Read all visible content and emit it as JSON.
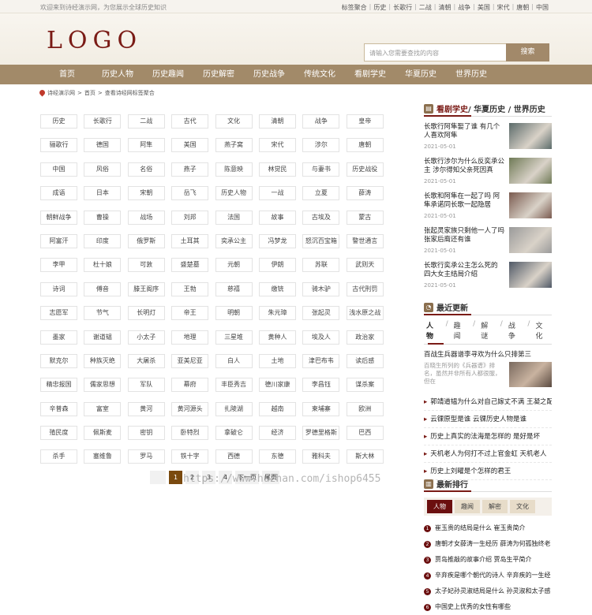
{
  "topbar": {
    "welcome": "欢迎来到诗经演示网，为您展示全球历史知识",
    "links": [
      "标签聚合",
      "历史",
      "长歌行",
      "二战",
      "清朝",
      "战争",
      "美国",
      "宋代",
      "唐朝",
      "中国"
    ]
  },
  "header": {
    "logo": "LOGO",
    "search_placeholder": "请输入您需要查找的内容",
    "search_button": "搜索"
  },
  "nav": [
    "首页",
    "历史人物",
    "历史趣闻",
    "历史解密",
    "历史战争",
    "传统文化",
    "看剧学史",
    "华夏历史",
    "世界历史"
  ],
  "breadcrumb": {
    "home": "诗经演示网",
    "sep": ">",
    "current_home": "首页",
    "current": "查看诗经网标签聚合"
  },
  "tags": [
    "历史",
    "长歌行",
    "二战",
    "古代",
    "文化",
    "清朝",
    "战争",
    "皇帝",
    "骊歌行",
    "德国",
    "阿隼",
    "美国",
    "燕子窝",
    "宋代",
    "涉尔",
    "唐朝",
    "中国",
    "风俗",
    "名俗",
    "燕子",
    "陈意映",
    "林觉民",
    "与妻书",
    "历史战役",
    "成语",
    "日本",
    "宋朝",
    "岳飞",
    "历史人物",
    "一战",
    "立夏",
    "薛涛",
    "朝鲜战争",
    "曹操",
    "战场",
    "刘邦",
    "法国",
    "故事",
    "古埃及",
    "蒙古",
    "阿富汗",
    "印度",
    "俄罗斯",
    "土耳其",
    "奕承公主",
    "冯梦龙",
    "怒沉百宝箱",
    "警世通言",
    "李甲",
    "杜十娘",
    "可敦",
    "盛楚墓",
    "元朝",
    "伊朗",
    "苏联",
    "武则天",
    "诗词",
    "傅音",
    "滕王阁序",
    "王勃",
    "慈禧",
    "缴铳",
    "骑木驴",
    "古代刑罚",
    "志愿军",
    "节气",
    "长明灯",
    "帝王",
    "明朝",
    "朱元璋",
    "张起灵",
    "浅水原之战",
    "墨家",
    "谢道韫",
    "小太子",
    "地理",
    "三星堆",
    "黄种人",
    "埃及人",
    "政治家",
    "默克尔",
    "种族灭绝",
    "大屠杀",
    "亚美尼亚",
    "白人",
    "土地",
    "津巴布韦",
    "读后感",
    "精忠报国",
    "儒家思想",
    "军队",
    "幕府",
    "丰臣秀吉",
    "德川家康",
    "李昌钰",
    "谋杀案",
    "辛普森",
    "富室",
    "黄河",
    "黄河源头",
    "扎陵湖",
    "越南",
    "柬埔寨",
    "欧洲",
    "殖民度",
    "佩斯麦",
    "密钥",
    "卧特烈",
    "拿破仑",
    "经济",
    "罗德里格斯",
    "巴西",
    "杀手",
    "塞维鲁",
    "罗马",
    "铁十字",
    "西德",
    "东德",
    "雅科夫",
    "斯大林"
  ],
  "pager": {
    "pages": [
      "1",
      "2",
      "3",
      "4"
    ],
    "current": "1",
    "next": "下一页",
    "last": "尾页"
  },
  "watermark": "https://www.huzhan.com/ishop6455",
  "sidebar1": {
    "title_hl": "看剧学史",
    "title_rest": " / 华夏历史 / 世界历史",
    "items": [
      {
        "title": "长歌行阿隼娶了谁 有几个人喜欢阿隼",
        "date": "2021-05-01"
      },
      {
        "title": "长歌行涉尔为什么反奕承公主 涉尔得知父亲死因真",
        "date": "2021-05-01"
      },
      {
        "title": "长歌和阿隼在一起了吗 阿隼承诺同长歌一起隐居",
        "date": "2021-05-01"
      },
      {
        "title": "张起灵家族只剩他一人了吗 张家后裔还有谁",
        "date": "2021-05-01"
      },
      {
        "title": "长歌行奕承公主怎么死的 四大女主结局介绍",
        "date": "2021-05-01"
      }
    ],
    "pic_colors": [
      "#5b6b6a",
      "#6f7a56",
      "#7a5a4f",
      "#9a9a9a",
      "#4f5866"
    ]
  },
  "sidebar2": {
    "title": "最近更新",
    "tabs": [
      "人物",
      "趣闻",
      "解谜",
      "战争",
      "文化"
    ],
    "first_title": "百战生兵器谱李寻欢为什么只排第三",
    "first_desc": "百晓生所列的《兵器谱》排名，虽然并非所有人都很服，但在",
    "items": [
      "郭靖道韫为什么对自己嫁丈不满 王凝之配",
      "云锞原型是谁 云锞历史人物是谁",
      "历史上真实的法海是怎样的 是好是坏",
      "天机老人为何打不过上官金虹 天机老人",
      "历史上刘曜是个怎样的君王"
    ]
  },
  "sidebar3": {
    "title": "最新排行",
    "tabs": [
      "人物",
      "趣闻",
      "解密",
      "文化"
    ],
    "items": [
      "崔玉贵的结局是什么 崔玉贵简介",
      "唐朝才女薛涛一生经历 薛涛为何孤独终老",
      "贾岛推敲的故事介绍 贾岛生平简介",
      "辛弃疾是哪个朝代的诗人 辛弃疾的一生经",
      "太子妃孙灵淑结局是什么 孙灵淑和太子感",
      "中国史上优秀的女性有哪些"
    ]
  }
}
